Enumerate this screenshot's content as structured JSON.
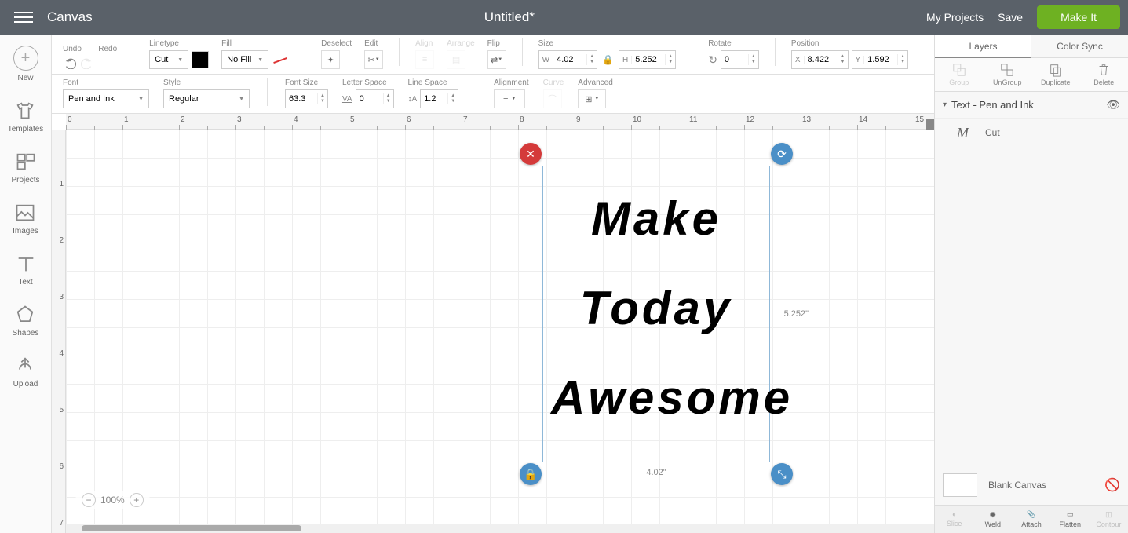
{
  "topbar": {
    "app": "Canvas",
    "doc": "Untitled*",
    "my_projects": "My Projects",
    "save": "Save",
    "make_it": "Make It"
  },
  "leftbar": {
    "new": "New",
    "templates": "Templates",
    "projects": "Projects",
    "images": "Images",
    "text": "Text",
    "shapes": "Shapes",
    "upload": "Upload"
  },
  "toolbar": {
    "undo": "Undo",
    "redo": "Redo",
    "linetype": "Linetype",
    "linetype_val": "Cut",
    "fill": "Fill",
    "fill_val": "No Fill",
    "deselect": "Deselect",
    "edit": "Edit",
    "align": "Align",
    "arrange": "Arrange",
    "flip": "Flip",
    "size": "Size",
    "w": "W",
    "w_val": "4.02",
    "h": "H",
    "h_val": "5.252",
    "rotate": "Rotate",
    "rotate_val": "0",
    "position": "Position",
    "x": "X",
    "x_val": "8.422",
    "y": "Y",
    "y_val": "1.592",
    "font": "Font",
    "font_val": "Pen and Ink",
    "style": "Style",
    "style_val": "Regular",
    "font_size": "Font Size",
    "font_size_val": "63.3",
    "letter_space": "Letter Space",
    "letter_space_val": "0",
    "line_space": "Line Space",
    "line_space_val": "1.2",
    "alignment": "Alignment",
    "curve": "Curve",
    "advanced": "Advanced"
  },
  "canvas": {
    "text_l1": "Make",
    "text_l2": "Today",
    "text_l3": "Awesome",
    "sel_w": "4.02\"",
    "sel_h": "5.252\"",
    "zoom": "100%"
  },
  "right": {
    "tab_layers": "Layers",
    "tab_colorsync": "Color Sync",
    "group": "Group",
    "ungroup": "UnGroup",
    "duplicate": "Duplicate",
    "delete": "Delete",
    "layer_name": "Text - Pen and Ink",
    "sublayer": "Cut",
    "blank": "Blank Canvas",
    "slice": "Slice",
    "weld": "Weld",
    "attach": "Attach",
    "flatten": "Flatten",
    "contour": "Contour"
  }
}
